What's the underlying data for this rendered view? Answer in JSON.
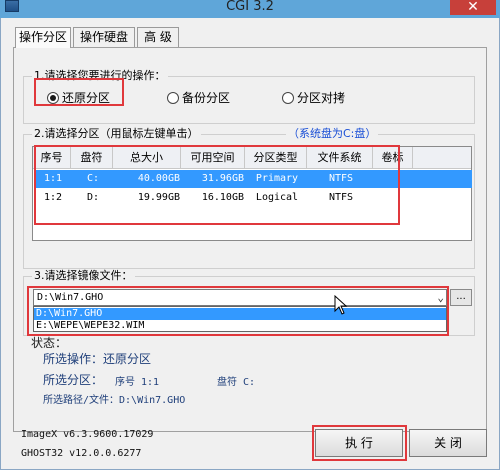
{
  "window": {
    "title": "CGI 3.2",
    "close_glyph": "✕"
  },
  "tabs": [
    {
      "label": "操作分区"
    },
    {
      "label": "操作硬盘"
    },
    {
      "label": "高 级"
    }
  ],
  "operation": {
    "label": "1.请选择您要进行的操作：",
    "options": [
      {
        "label": "还原分区",
        "checked": true
      },
      {
        "label": "备份分区",
        "checked": false
      },
      {
        "label": "分区对拷",
        "checked": false
      }
    ]
  },
  "partition": {
    "label": "2.请选择分区（用鼠标左键单击）",
    "system_disk_note": "（系统盘为C:盘）",
    "columns": [
      "序号",
      "盘符",
      "总大小",
      "可用空间",
      "分区类型",
      "文件系统",
      "卷标"
    ],
    "rows": [
      {
        "cells": [
          "1:1",
          "C:",
          "40.00GB",
          "31.96GB",
          "Primary",
          "NTFS",
          ""
        ],
        "selected": true
      },
      {
        "cells": [
          "1:2",
          "D:",
          "19.99GB",
          "16.10GB",
          "Logical",
          "NTFS",
          ""
        ],
        "selected": false
      }
    ]
  },
  "image": {
    "label": "3.请选择镜像文件：",
    "combo_value": "D:\\Win7.GHO",
    "browse_label": "...",
    "dropdown_items": [
      {
        "label": "D:\\Win7.GHO",
        "selected": true
      },
      {
        "label": "E:\\WEPE\\WEPE32.WIM",
        "selected": false
      }
    ]
  },
  "status": {
    "label": "状态：",
    "operation_line": "所选操作：还原分区",
    "partition_prefix": "所选分区：",
    "partition_index_label": "序号 1:1",
    "partition_drive_label": "盘符 C:",
    "path_line": "所选路径/文件：D:\\Win7.GHO"
  },
  "versions": {
    "imagex": "ImageX v6.3.9600.17029",
    "ghost": "GHOST32 v12.0.0.6277"
  },
  "buttons": {
    "execute": "执 行",
    "close": "关 闭"
  },
  "colors": {
    "selection": "#3399ff",
    "highlight_box": "#e0383c",
    "link_blue": "#1a4fd6"
  }
}
